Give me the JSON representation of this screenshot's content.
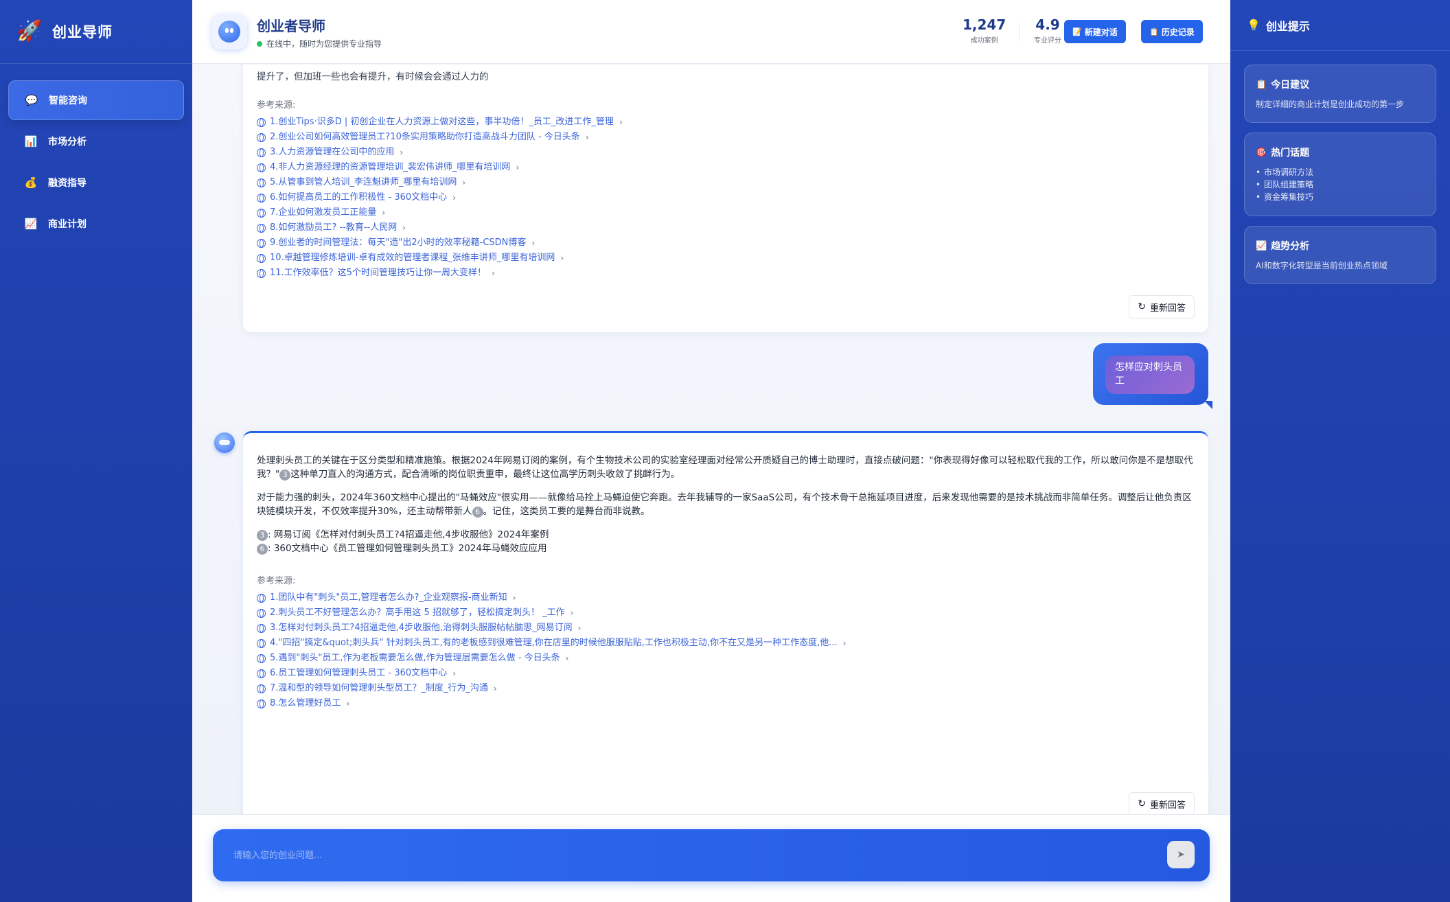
{
  "sidebar": {
    "brand": "创业导师",
    "items": [
      {
        "label": "智能咨询",
        "icon": "chat-bubble-icon"
      },
      {
        "label": "市场分析",
        "icon": "bar-chart-icon"
      },
      {
        "label": "融资指导",
        "icon": "money-bag-icon"
      },
      {
        "label": "商业计划",
        "icon": "trend-chart-icon"
      }
    ]
  },
  "header": {
    "title": "创业者导师",
    "status": "在线中，随时为您提供专业指导",
    "stats": [
      {
        "value": "1,247",
        "label": "成功案例"
      },
      {
        "value": "4.9",
        "label": "专业评分"
      }
    ],
    "new_chat": "新建对话",
    "history": "历史记录"
  },
  "chat": {
    "cut_text": "提升了，但加班一些也会有提升，有时候会会通过人力的",
    "msg1": {
      "ref_head": "参考来源:",
      "refs": [
        "1.创业Tips·识多D | 初创企业在人力资源上做对这些，事半功倍！_员工_改进工作_管理",
        "2.创业公司如何高效管理员工?10条实用策略助你打造高战斗力团队 - 今日头条",
        "3.人力资源管理在公司中的应用",
        "4.非人力资源经理的资源管理培训_裴宏伟讲师_哪里有培训网",
        "5.从管事到管人培训_李连魁讲师_哪里有培训网",
        "6.如何提高员工的工作积极性 - 360文档中心",
        "7.企业如何激发员工正能量",
        "8.如何激励员工? --教育--人民网",
        "9.创业者的时间管理法：每天\"造\"出2小时的效率秘籍-CSDN博客",
        "10.卓越管理修炼培训-卓有成效的管理者课程_张维丰讲师_哪里有培训网",
        "11.工作效率低？这5个时间管理技巧让你一周大变样！"
      ],
      "regen": "重新回答"
    },
    "user_msg": "怎样应对刺头员工",
    "msg2": {
      "p1": "处理刺头员工的关键在于区分类型和精准施策。根据2024年网易订阅的案例，有个生物技术公司的实验室经理面对经常公开质疑自己的博士助理时，直接点破问题：\"你表现得好像可以轻松取代我的工作，所以敢问你是不是想取代我？\"",
      "p1_cite": "3",
      "p1_tail": "这种单刀直入的沟通方式，配合清晰的岗位职责重申，最终让这位高学历刺头收敛了挑衅行为。",
      "p2": "对于能力强的刺头，2024年360文档中心提出的\"马蝇效应\"很实用——就像给马拴上马蝇迫使它奔跑。去年我辅导的一家SaaS公司，有个技术骨干总拖延项目进度，后来发现他需要的是技术挑战而非简单任务。调整后让他负责区块链模块开发，不仅效率提升30%，还主动帮带新人",
      "p2_cite": "6",
      "p2_tail": "。记住，这类员工要的是舞台而非说教。",
      "notes": [
        {
          "cite": "3",
          "text": ": 网易订阅《怎样对付刺头员工?4招逼走他,4步收服他》2024年案例"
        },
        {
          "cite": "6",
          "text": ": 360文档中心《员工管理如何管理刺头员工》2024年马蝇效应应用"
        }
      ],
      "ref_head": "参考来源:",
      "refs": [
        "1.团队中有\"刺头\"员工,管理者怎么办?_企业观察报-商业新知",
        "2.刺头员工不好管理怎么办？高手用这 5 招就够了，轻松搞定刺头！ _工作",
        "3.怎样对付刺头员工?4招逼走他,4步收服他,治得刺头服服帖帖脑思_网易订阅",
        "4.\"四招\"搞定&quot;刺头兵\" 针对刺头员工,有的老板感到很难管理,你在店里的时候他服服贴贴,工作也积极主动,你不在又是另一种工作态度,他...",
        "5.遇到\"刺头\"员工,作为老板需要怎么做,作为管理层需要怎么做 - 今日头条",
        "6.员工管理如何管理刺头员工 - 360文档中心",
        "7.温和型的领导如何管理刺头型员工？_制度_行为_沟通",
        "8.怎么管理好员工"
      ],
      "regen": "重新回答"
    }
  },
  "input": {
    "placeholder": "请输入您的创业问题..."
  },
  "rpanel": {
    "title": "创业提示",
    "cards": [
      {
        "title": "今日建议",
        "desc": "制定详细的商业计划是创业成功的第一步"
      },
      {
        "title": "热门话题",
        "items": [
          "市场调研方法",
          "团队组建策略",
          "资金筹集技巧"
        ]
      },
      {
        "title": "趋势分析",
        "desc": "AI和数字化转型是当前创业热点领域"
      }
    ]
  },
  "colors": {
    "primary": "#2563eb",
    "sidebar": "#1e3ea8",
    "link": "#3b63d8"
  }
}
